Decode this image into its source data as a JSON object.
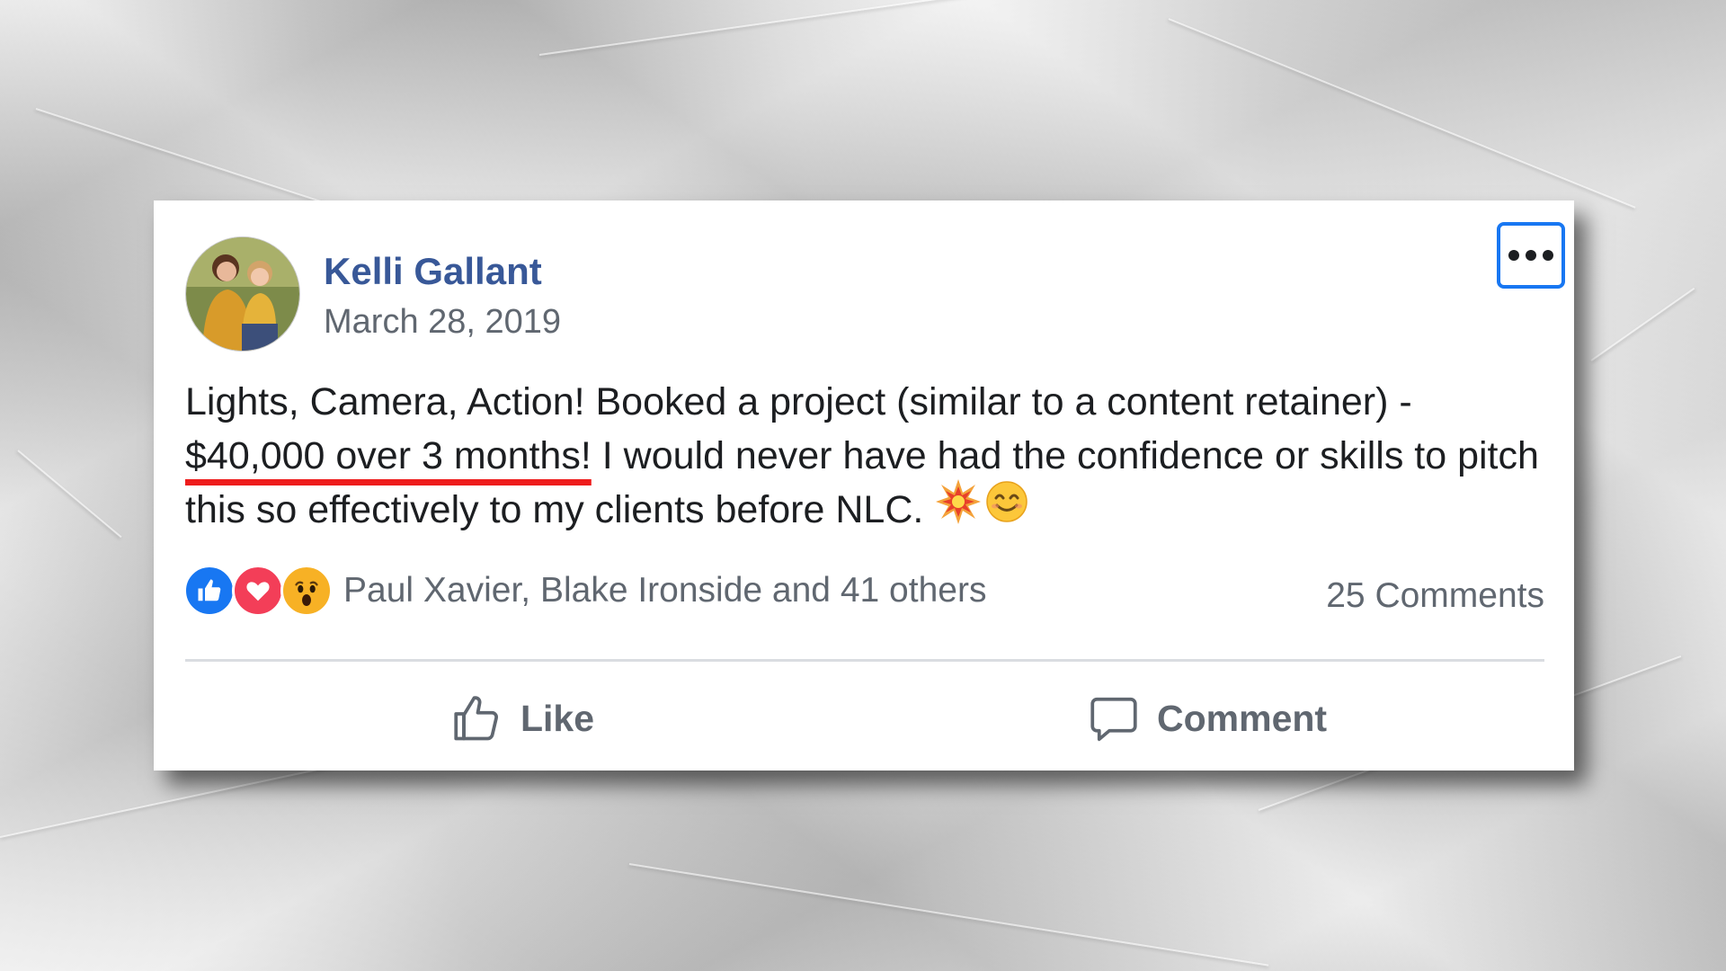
{
  "post": {
    "author": "Kelli Gallant",
    "date": "March 28, 2019",
    "text": {
      "before": "Lights, Camera, Action! Booked a project (similar to a content retainer) - ",
      "highlight": "$40,000 over 3 months!",
      "after": " I would never have had the confidence or skills to pitch this so effectively to my clients before NLC. "
    },
    "emojis": [
      "explosion-emoji",
      "smiling-face-emoji"
    ],
    "reactions": {
      "icons": [
        "like-reaction-icon",
        "love-reaction-icon",
        "wow-reaction-icon"
      ],
      "reactors_text": "Paul Xavier, Blake Ironside and 41 others",
      "comments_count": "25 Comments"
    },
    "actions": {
      "like_label": "Like",
      "comment_label": "Comment"
    }
  },
  "colors": {
    "author_link": "#385898",
    "secondary_text": "#606770",
    "highlight_underline": "#ee1c1c",
    "more_button_border": "#1877f2",
    "like_blue": "#1877f2",
    "love_red": "#f33e58",
    "wow_yellow": "#f7b125"
  }
}
